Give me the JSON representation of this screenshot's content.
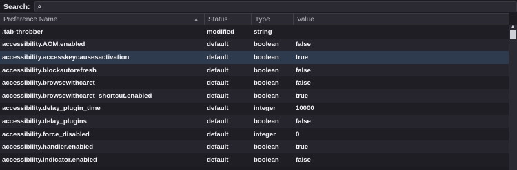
{
  "search": {
    "label": "Search:",
    "placeholder": "",
    "icon": "search-icon"
  },
  "columns": {
    "name": "Preference Name",
    "status": "Status",
    "type": "Type",
    "value": "Value"
  },
  "rows": [
    {
      "name": ".tab-throbber",
      "status": "modified",
      "type": "string",
      "value": "",
      "selected": false
    },
    {
      "name": "accessibility.AOM.enabled",
      "status": "default",
      "type": "boolean",
      "value": "false",
      "selected": false
    },
    {
      "name": "accessibility.accesskeycausesactivation",
      "status": "default",
      "type": "boolean",
      "value": "true",
      "selected": true
    },
    {
      "name": "accessibility.blockautorefresh",
      "status": "default",
      "type": "boolean",
      "value": "false",
      "selected": false
    },
    {
      "name": "accessibility.browsewithcaret",
      "status": "default",
      "type": "boolean",
      "value": "false",
      "selected": false
    },
    {
      "name": "accessibility.browsewithcaret_shortcut.enabled",
      "status": "default",
      "type": "boolean",
      "value": "true",
      "selected": false
    },
    {
      "name": "accessibility.delay_plugin_time",
      "status": "default",
      "type": "integer",
      "value": "10000",
      "selected": false
    },
    {
      "name": "accessibility.delay_plugins",
      "status": "default",
      "type": "boolean",
      "value": "false",
      "selected": false
    },
    {
      "name": "accessibility.force_disabled",
      "status": "default",
      "type": "integer",
      "value": "0",
      "selected": false
    },
    {
      "name": "accessibility.handler.enabled",
      "status": "default",
      "type": "boolean",
      "value": "true",
      "selected": false
    },
    {
      "name": "accessibility.indicator.enabled",
      "status": "default",
      "type": "boolean",
      "value": "false",
      "selected": false
    }
  ],
  "colors": {
    "selected_row": "#2e3a4d",
    "background": "#1c1b22"
  }
}
